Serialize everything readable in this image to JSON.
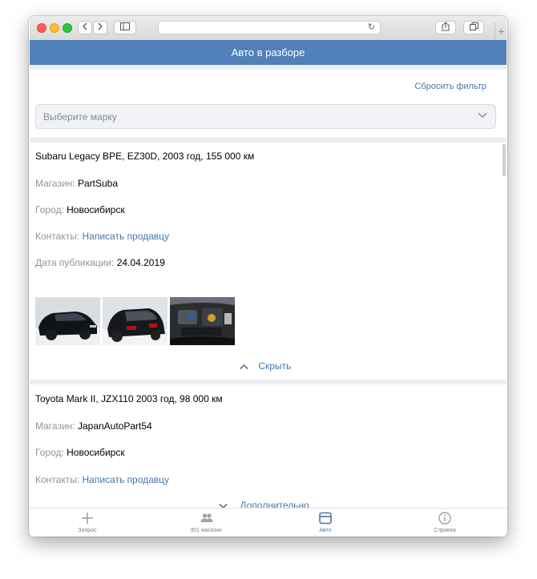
{
  "header": {
    "title": "Авто в разборе"
  },
  "filter": {
    "reset_label": "Сбросить фильтр",
    "brand_placeholder": "Выберите марку"
  },
  "cards": [
    {
      "title": "Subaru Legacy BPE, EZ30D, 2003 год, 155 000 км",
      "shop_label": "Магазин:",
      "shop": "PartSuba",
      "city_label": "Город:",
      "city": "Новосибирск",
      "contacts_label": "Контакты:",
      "contacts_link": "Написать продавцу",
      "date_label": "Дата публикации:",
      "date": "24.04.2019",
      "toggle_label": "Скрыть"
    },
    {
      "title": "Toyota Mark II, JZX110 2003 год, 98 000 км",
      "shop_label": "Магазин:",
      "shop": "JapanAutoPart54",
      "city_label": "Город:",
      "city": "Новосибирск",
      "contacts_label": "Контакты:",
      "contacts_link": "Написать продавцу",
      "toggle_label": "Дополнительно"
    }
  ],
  "tabbar": {
    "items": [
      {
        "label": "Запрос",
        "icon": "plus-icon"
      },
      {
        "label": "301 магазин",
        "icon": "users-icon"
      },
      {
        "label": "Авто",
        "icon": "car-icon",
        "active": true
      },
      {
        "label": "Справка",
        "icon": "info-icon"
      }
    ]
  },
  "colors": {
    "accent": "#5181b8",
    "link": "#4a76a8",
    "label_gray": "#939393",
    "divider": "#ebedf0"
  }
}
